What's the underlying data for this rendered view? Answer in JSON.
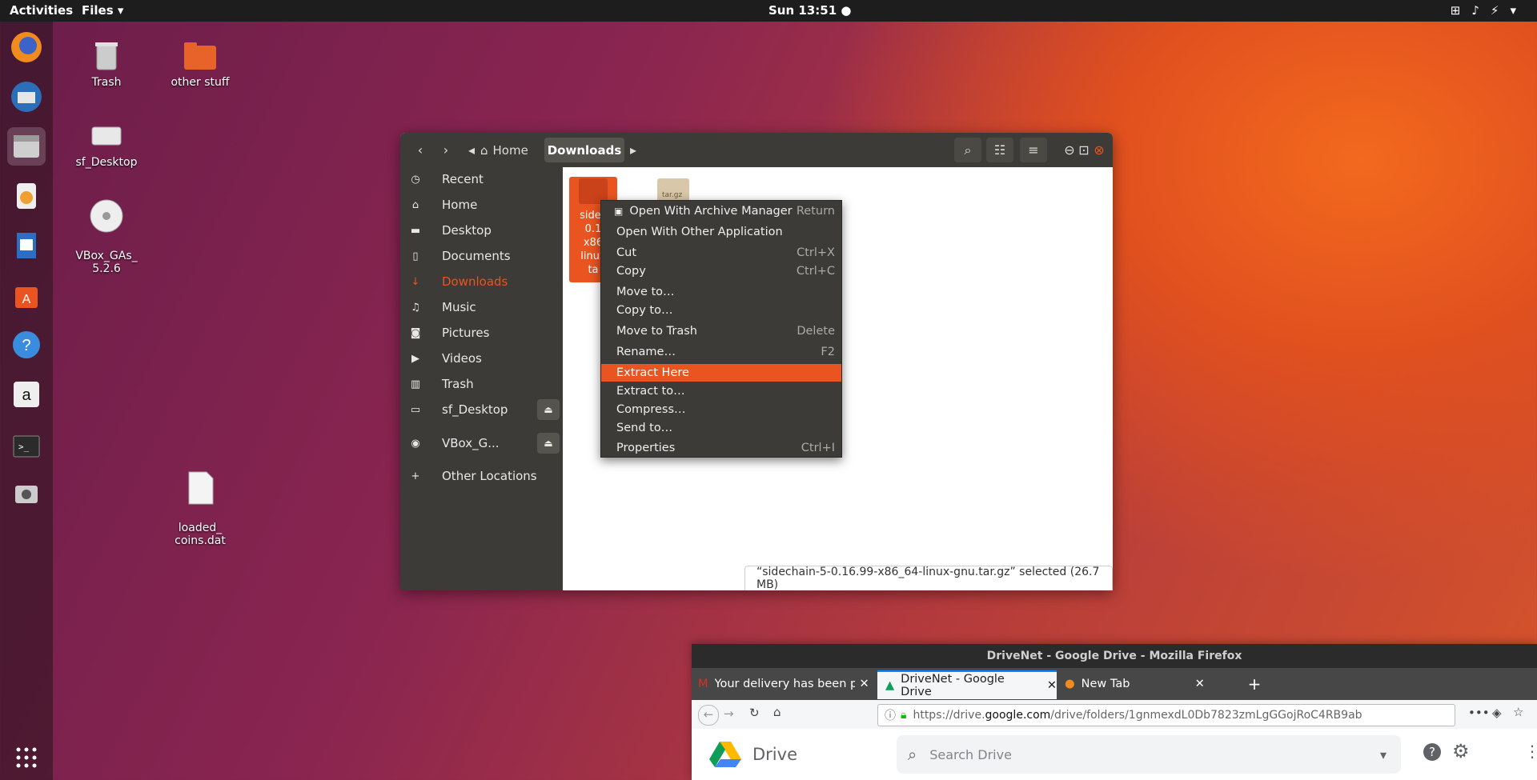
{
  "topbar": {
    "activities": "Activities",
    "app_menu": "Files ▾",
    "clock": "Sun 13:51 ●"
  },
  "desktop": {
    "icons": [
      {
        "label": "Trash"
      },
      {
        "label": "other stuff"
      },
      {
        "label": "sf_Desktop"
      },
      {
        "label": "VBox_GAs_\n5.2.6"
      },
      {
        "label": "loaded_\ncoins.dat"
      }
    ]
  },
  "files_window": {
    "breadcrumbs": [
      "Home",
      "Downloads"
    ],
    "sidebar": [
      {
        "label": "Recent",
        "icon": "clock-icon"
      },
      {
        "label": "Home",
        "icon": "home-icon"
      },
      {
        "label": "Desktop",
        "icon": "folder-icon"
      },
      {
        "label": "Documents",
        "icon": "document-icon"
      },
      {
        "label": "Downloads",
        "icon": "download-icon"
      },
      {
        "label": "Music",
        "icon": "music-icon"
      },
      {
        "label": "Pictures",
        "icon": "camera-icon"
      },
      {
        "label": "Videos",
        "icon": "video-icon"
      },
      {
        "label": "Trash",
        "icon": "trash-icon"
      },
      {
        "label": "sf_Desktop",
        "icon": "drive-icon"
      },
      {
        "label": "VBox_G...",
        "icon": "disc-icon"
      },
      {
        "label": "Other Locations",
        "icon": "plus-icon"
      }
    ],
    "selected_file_label": "sidec\n0.1\nx86\nlinux\nta",
    "other_file_label": "tar.gz",
    "status": "“sidechain-5-0.16.99-x86_64-linux-gnu.tar.gz” selected  (26.7 MB)"
  },
  "context_menu": {
    "items": [
      {
        "label": "Open With Archive Manager",
        "shortcut": "Return"
      },
      {
        "label": "Open With Other Application",
        "shortcut": ""
      },
      {
        "label": "Cut",
        "shortcut": "Ctrl+X"
      },
      {
        "label": "Copy",
        "shortcut": "Ctrl+C"
      },
      {
        "label": "Move to…",
        "shortcut": ""
      },
      {
        "label": "Copy to…",
        "shortcut": ""
      },
      {
        "label": "Move to Trash",
        "shortcut": "Delete"
      },
      {
        "label": "Rename…",
        "shortcut": "F2"
      },
      {
        "label": "Extract Here",
        "shortcut": ""
      },
      {
        "label": "Extract to…",
        "shortcut": ""
      },
      {
        "label": "Compress…",
        "shortcut": ""
      },
      {
        "label": "Send to…",
        "shortcut": ""
      },
      {
        "label": "Properties",
        "shortcut": "Ctrl+I"
      }
    ],
    "highlighted": "Extract Here"
  },
  "firefox": {
    "title": "DriveNet - Google Drive - Mozilla Firefox",
    "tabs": [
      {
        "label": "Your delivery has been p"
      },
      {
        "label": "DriveNet - Google Drive"
      },
      {
        "label": "New Tab"
      }
    ],
    "url_prefix": "https://drive.",
    "url_host": "google.com",
    "url_rest": "/drive/folders/1gnmexdL0Db7823zmLgGGojRoC4RB9ab",
    "drive_label": "Drive",
    "search_placeholder": "Search Drive"
  }
}
